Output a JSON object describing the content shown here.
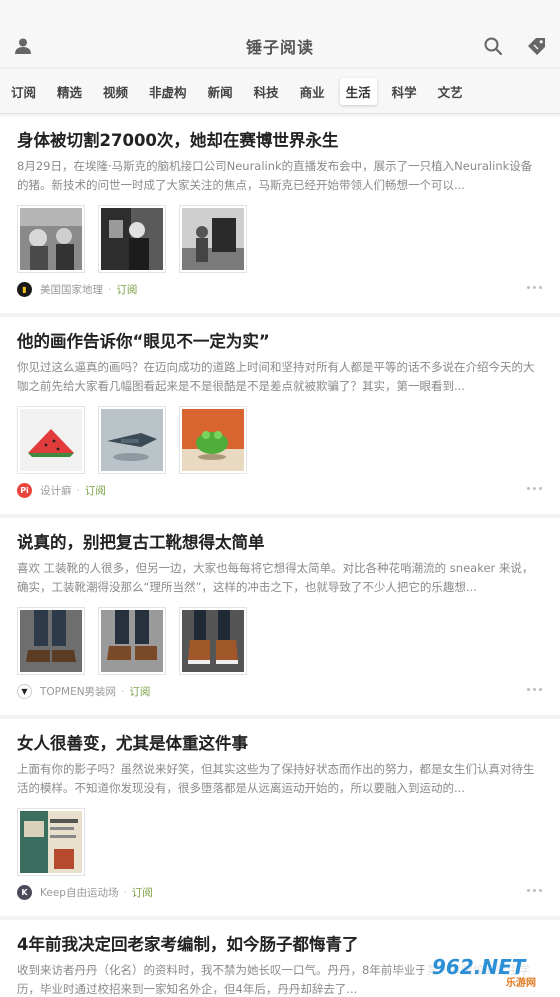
{
  "app": {
    "title": "锤子阅读"
  },
  "tabs": [
    {
      "label": "订阅"
    },
    {
      "label": "精选"
    },
    {
      "label": "视频"
    },
    {
      "label": "非虚构"
    },
    {
      "label": "新闻"
    },
    {
      "label": "科技"
    },
    {
      "label": "商业"
    },
    {
      "label": "生活"
    },
    {
      "label": "科学"
    },
    {
      "label": "文艺"
    }
  ],
  "active_tab": "生活",
  "colors": {
    "accent_green": "#7a9e41",
    "text_dark": "#222222",
    "text_gray": "#8a8a8a"
  },
  "icons": {
    "profile": "person-icon",
    "search": "search-icon",
    "tag": "tag-icon"
  },
  "articles": [
    {
      "title": "身体被切割27000次，她却在赛博世界永生",
      "summary": "8月29日，在埃隆·马斯克的脑机接口公司Neuralink的直播发布会中，展示了一只植入Neuralink设备的猪。新技术的问世一时成了大家关注的焦点，马斯克已经开始带领人们畅想一个可以...",
      "source": "美国国家地理",
      "subscribe": "订阅"
    },
    {
      "title": "他的画作告诉你“眼见不一定为实”",
      "summary": "你见过这么逼真的画吗？在迈向成功的道路上时间和坚持对所有人都是平等的话不多说在介绍今天的大咖之前先给大家看几幅图看起来是不是很酷是不是差点就被欺骗了？其实，第一眼看到...",
      "source": "设计癖",
      "subscribe": "订阅"
    },
    {
      "title": "说真的，别把复古工靴想得太简单",
      "summary": "喜欢 工装靴的人很多，但另一边，大家也每每将它想得太简单。对比各种花哨潮流的 sneaker 来说， 确实，工装靴潮得没那么“理所当然”，这样的冲击之下，也就导致了不少人把它的乐趣想...",
      "source": "TOPMEN男装网",
      "subscribe": "订阅"
    },
    {
      "title": "女人很善变，尤其是体重这件事",
      "summary": "上面有你的影子吗？虽然说来好笑，但其实这些为了保持好状态而作出的努力，都是女生们认真对待生活的模样。不知道你发现没有，很多堕落都是从远离运动开始的，所以要融入到运动的...",
      "source": "Keep自由运动场",
      "subscribe": "订阅"
    },
    {
      "title": "4年前我决定回老家考编制，如今肠子都悔青了",
      "summary": "收到来访者丹丹（化名）的资料时，我不禁为她长叹一口气。丹丹，8年前毕业于某一本院校研究生学历，毕业时通过校招来到一家知名外企，但4年后，丹丹却辞去了..."
    }
  ],
  "watermark": {
    "text": "962.NET",
    "subtext": "乐游网"
  }
}
